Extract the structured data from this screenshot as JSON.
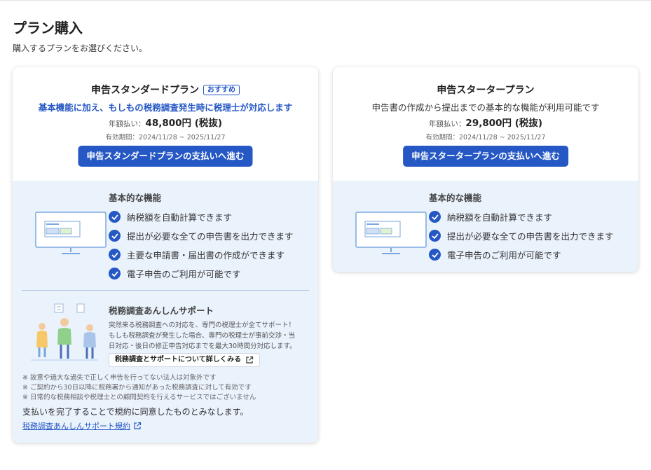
{
  "page": {
    "title": "プラン購入",
    "subtitle": "購入するプランをお選びください。"
  },
  "plans": [
    {
      "name": "申告スタンダードプラン",
      "badge": "おすすめ",
      "description": "基本機能に加え、もしもの税務調査発生時に税理士が対応します",
      "price_label": "年額払い：",
      "price": "48,800円 (税抜)",
      "period": "有効期間：2024/11/28 ~ 2025/11/27",
      "button": "申告スタンダードプランの支払いへ進む",
      "features_title": "基本的な機能",
      "features": [
        "納税額を自動計算できます",
        "提出が必要な全ての申告書を出力できます",
        "主要な申請書・届出書の作成ができます",
        "電子申告のご利用が可能です"
      ],
      "support": {
        "title": "税務調査あんしんサポート",
        "lines": [
          "突然来る税務調査への対応を、専門の税理士が全てサポート！",
          "もしも税務調査が発生した場合、専門の税理士が事前交渉・当",
          "日対応・後日の修正申告対応までを最大30時間分対応します。"
        ],
        "button": "税務調査とサポートについて詳しくみる"
      },
      "notes": [
        "※ 故意や過大な過失で正しく申告を行ってない法人は対象外です",
        "※ ご契約から30日以降に税務署から通知があった税務調査に対して有効です",
        "※ 日常的な税務相談や税理士との顧問契約を行えるサービスではございません"
      ],
      "agreement": "支払いを完了することで規約に同意したものとみなします。",
      "terms_link": "税務調査あんしんサポート規約"
    },
    {
      "name": "申告スタータープラン",
      "description": "申告書の作成から提出までの基本的な機能が利用可能です",
      "price_label": "年額払い：",
      "price": "29,800円 (税抜)",
      "period": "有効期間：2024/11/28 ~ 2025/11/27",
      "button": "申告スタータープランの支払いへ進む",
      "features_title": "基本的な機能",
      "features": [
        "納税額を自動計算できます",
        "提出が必要な全ての申告書を出力できます",
        "電子申告のご利用が可能です"
      ]
    }
  ],
  "icons": {
    "check": "check-circle-icon",
    "external": "external-link-icon",
    "monitor": "monitor-illustration",
    "people": "support-people-illustration"
  },
  "colors": {
    "accent": "#2557c5",
    "feature_bg": "#eaf2fc",
    "card_bg": "#ffffff"
  }
}
